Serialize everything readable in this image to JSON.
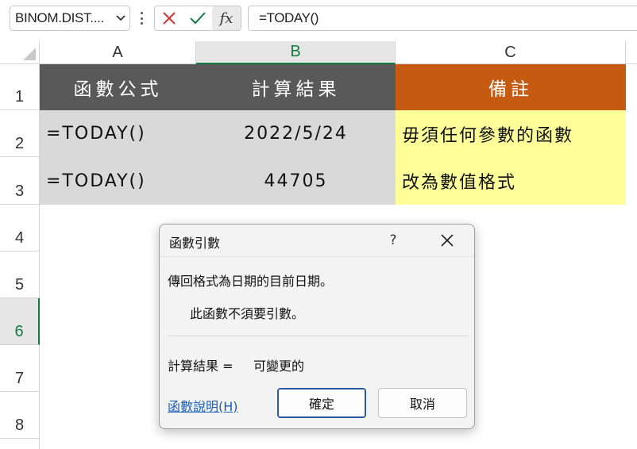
{
  "formula_bar": {
    "name_box": "BINOM.DIST....",
    "formula": "=TODAY()",
    "fx_label": "fx",
    "icons": [
      "cancel-icon",
      "enter-icon",
      "insert-function-icon",
      "more-options-icon",
      "chevron-down-icon"
    ]
  },
  "grid": {
    "columns": [
      "A",
      "B",
      "C"
    ],
    "rows": [
      "1",
      "2",
      "3",
      "4",
      "5",
      "6",
      "7",
      "8"
    ],
    "selected_column": "B",
    "selected_row": "6",
    "cells": {
      "A1": "函數公式",
      "B1": "計算結果",
      "C1": "備註",
      "A2": "=TODAY()",
      "B2": "2022/5/24",
      "C2": "毋須任何參數的函數",
      "A3": "=TODAY()",
      "B3": "44705",
      "C3": "改為數值格式"
    },
    "colors": {
      "header_dark": "#595959",
      "body_gray": "#d9d9d9",
      "note_header": "#c55a11",
      "note_body": "#ffff99",
      "selection_green": "#107c41"
    }
  },
  "dialog": {
    "title": "函數引數",
    "help": "?",
    "description": "傳回格式為日期的目前日期。",
    "argument_note": "此函數不須要引數。",
    "result_label": "計算結果 =",
    "result_value": "可變更的",
    "help_link": "函數說明(H)",
    "ok_label": "確定",
    "cancel_label": "取消"
  }
}
